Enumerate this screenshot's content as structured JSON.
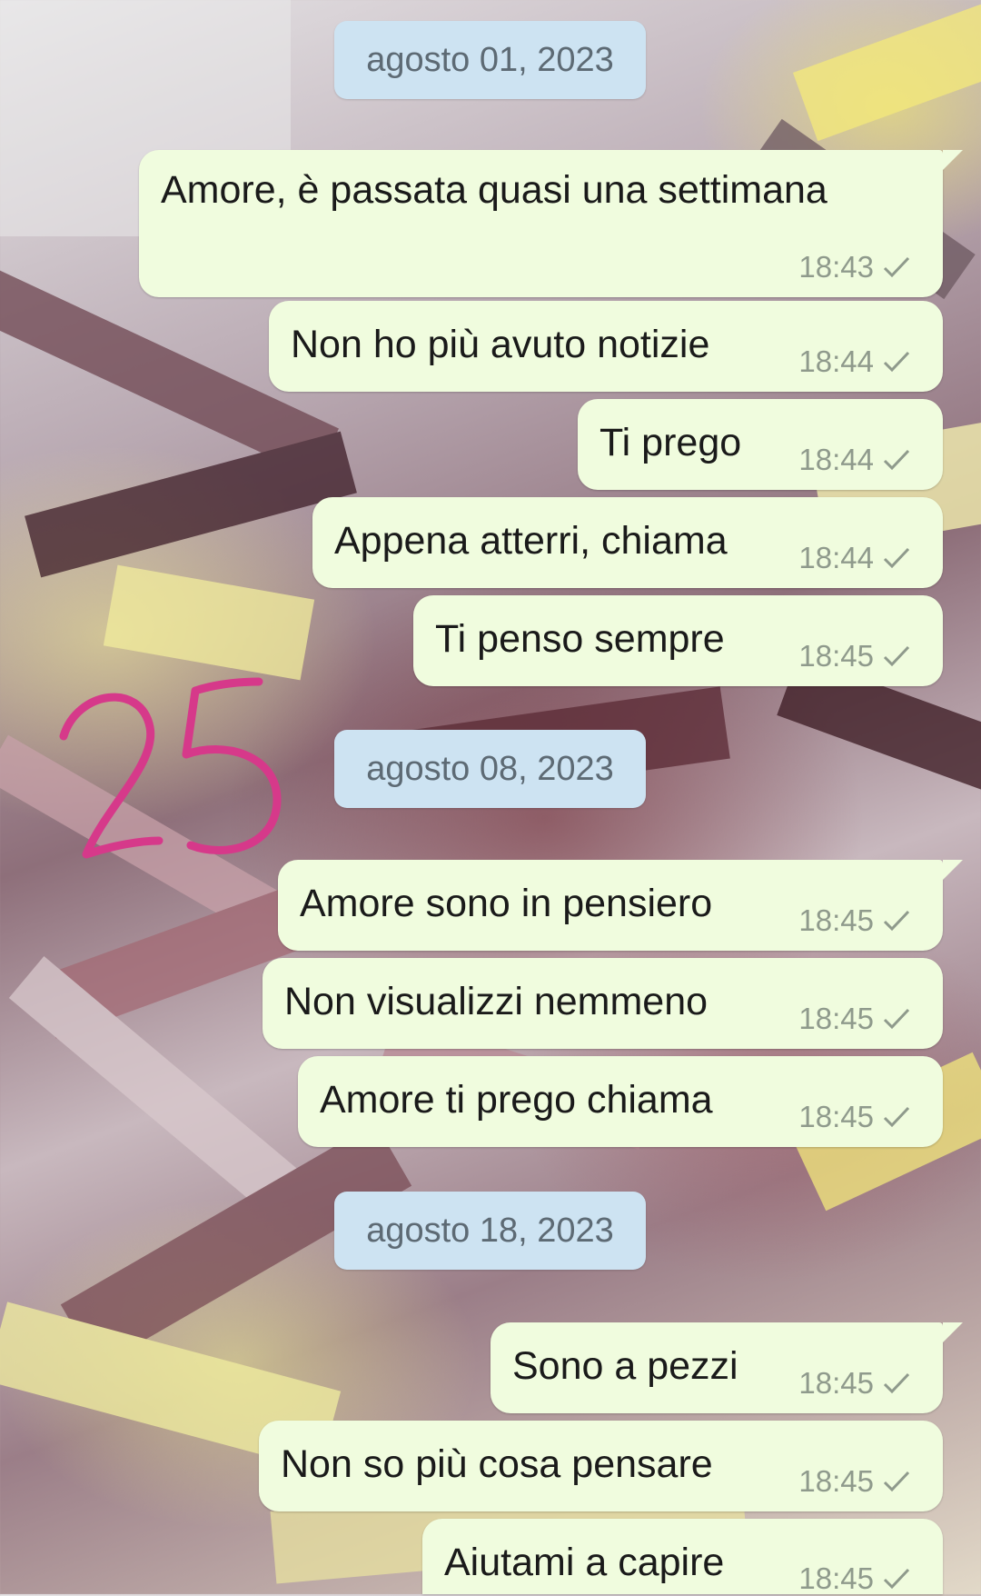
{
  "colors": {
    "outgoing_bubble": "#f0fcde",
    "date_pill": "#cde3f2",
    "timestamp": "#8f9a8c",
    "annotation": "#d6398a"
  },
  "overlay_annotation": "25",
  "conversation": [
    {
      "date": "agosto 01, 2023",
      "messages": [
        {
          "text": "Amore, è passata quasi una settimana",
          "time": "18:43",
          "status": "sent-check-icon"
        },
        {
          "text": "Non ho più avuto notizie",
          "time": "18:44",
          "status": "sent-check-icon"
        },
        {
          "text": "Ti prego",
          "time": "18:44",
          "status": "sent-check-icon"
        },
        {
          "text": "Appena atterri, chiama",
          "time": "18:44",
          "status": "sent-check-icon"
        },
        {
          "text": "Ti penso sempre",
          "time": "18:45",
          "status": "sent-check-icon"
        }
      ]
    },
    {
      "date": "agosto 08, 2023",
      "messages": [
        {
          "text": "Amore sono in pensiero",
          "time": "18:45",
          "status": "sent-check-icon"
        },
        {
          "text": "Non visualizzi nemmeno",
          "time": "18:45",
          "status": "sent-check-icon"
        },
        {
          "text": "Amore ti prego chiama",
          "time": "18:45",
          "status": "sent-check-icon"
        }
      ]
    },
    {
      "date": "agosto 18, 2023",
      "messages": [
        {
          "text": "Sono a pezzi",
          "time": "18:45",
          "status": "sent-check-icon"
        },
        {
          "text": "Non so più cosa pensare",
          "time": "18:45",
          "status": "sent-check-icon"
        },
        {
          "text": "Aiutami a capire",
          "time": "18:45",
          "status": "sent-check-icon"
        }
      ]
    }
  ]
}
